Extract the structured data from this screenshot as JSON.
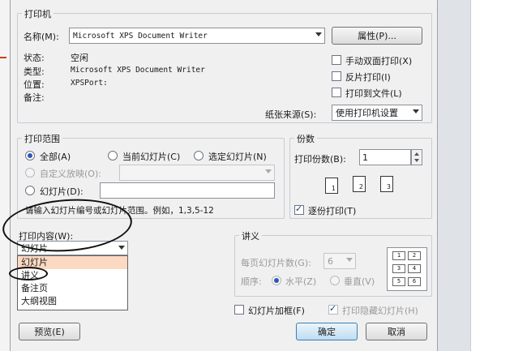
{
  "printer": {
    "group_title": "打印机",
    "name_label": "名称(M):",
    "name_value": "Microsoft XPS Document Writer",
    "properties_button": "属性(P)...",
    "status_label": "状态:",
    "status_value": "空闲",
    "type_label": "类型:",
    "type_value": "Microsoft XPS Document Writer",
    "where_label": "位置:",
    "where_value": "XPSPort:",
    "comment_label": "备注:",
    "duplex_label": "手动双面打印(X)",
    "reverse_label": "反片打印(I)",
    "print_to_file_label": "打印到文件(L)",
    "paper_source_label": "纸张来源(S):",
    "paper_source_value": "使用打印机设置"
  },
  "range": {
    "group_title": "打印范围",
    "all_label": "全部(A)",
    "current_label": "当前幻灯片(C)",
    "selection_label": "选定幻灯片(N)",
    "custom_show_label": "自定义放映(O):",
    "slides_label": "幻灯片(D):",
    "hint": "请输入幻灯片编号或幻灯片范围。例如，1,3,5-12"
  },
  "copies": {
    "group_title": "份数",
    "count_label": "打印份数(B):",
    "count_value": "1",
    "collate_label": "逐份打印(T)",
    "collate_page_numbers": [
      "1",
      "2",
      "3"
    ]
  },
  "print_what": {
    "label": "打印内容(W):",
    "selected": "幻灯片",
    "options": [
      "幻灯片",
      "讲义",
      "备注页",
      "大纲视图"
    ]
  },
  "handouts": {
    "group_title": "讲义",
    "per_page_label": "每页幻灯片数(G):",
    "per_page_value": "6",
    "order_label": "顺序:",
    "horizontal_label": "水平(Z)",
    "vertical_label": "垂直(V)",
    "preview_cells": [
      "1",
      "2",
      "3",
      "4",
      "5",
      "6"
    ]
  },
  "options": {
    "frame_slides_label": "幻灯片加框(F)",
    "print_hidden_label": "打印隐藏幻灯片(H)"
  },
  "footer": {
    "preview_button": "预览(E)",
    "ok_button": "确定",
    "cancel_button": "取消"
  }
}
